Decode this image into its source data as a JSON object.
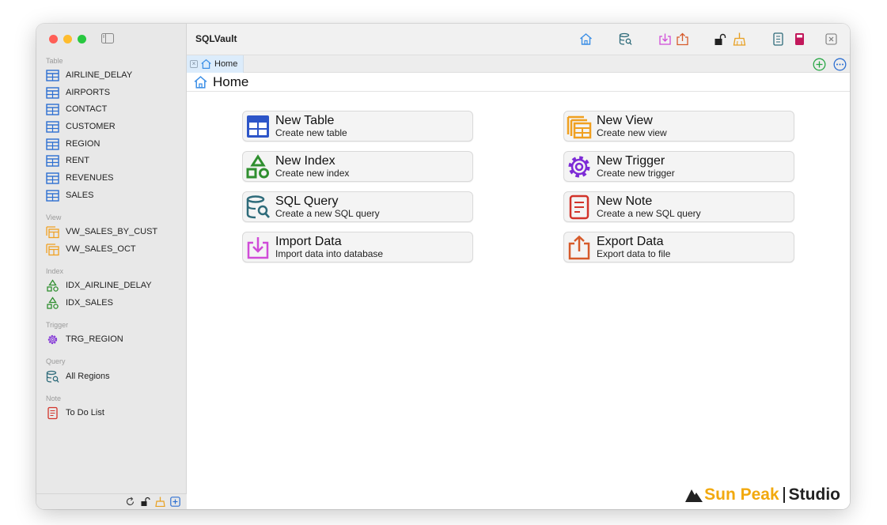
{
  "app": {
    "title": "SQLVault"
  },
  "sidebar": {
    "sections": [
      {
        "label": "Table",
        "items": [
          "AIRLINE_DELAY",
          "AIRPORTS",
          "CONTACT",
          "CUSTOMER",
          "REGION",
          "RENT",
          "REVENUES",
          "SALES"
        ]
      },
      {
        "label": "View",
        "items": [
          "VW_SALES_BY_CUST",
          "VW_SALES_OCT"
        ]
      },
      {
        "label": "Index",
        "items": [
          "IDX_AIRLINE_DELAY",
          "IDX_SALES"
        ]
      },
      {
        "label": "Trigger",
        "items": [
          "TRG_REGION"
        ]
      },
      {
        "label": "Query",
        "items": [
          "All Regions"
        ]
      },
      {
        "label": "Note",
        "items": [
          "To Do List"
        ]
      }
    ]
  },
  "tabs": [
    {
      "label": "Home"
    }
  ],
  "page": {
    "title": "Home"
  },
  "cards": [
    {
      "title": "New Table",
      "subtitle": "Create new table"
    },
    {
      "title": "New View",
      "subtitle": "Create new view"
    },
    {
      "title": "New Index",
      "subtitle": "Create new index"
    },
    {
      "title": "New Trigger",
      "subtitle": "Create new trigger"
    },
    {
      "title": "SQL Query",
      "subtitle": "Create a new SQL query"
    },
    {
      "title": "New Note",
      "subtitle": "Create a new SQL query"
    },
    {
      "title": "Import Data",
      "subtitle": "Import data into database"
    },
    {
      "title": "Export Data",
      "subtitle": "Export data to file"
    }
  ],
  "brand": {
    "sun_peak": "Sun Peak",
    "studio": "Studio"
  },
  "colors": {
    "table": "#2d6fd1",
    "view": "#f0a020",
    "index": "#2f8f2f",
    "trigger": "#7d2bd6",
    "query": "#2e6b7a",
    "note": "#d2332a",
    "import": "#d04bd8",
    "export": "#d65a2a",
    "brand_sun": "#f2a90e"
  }
}
